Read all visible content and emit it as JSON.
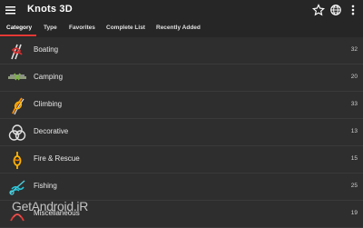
{
  "app": {
    "title": "Knots 3D"
  },
  "tabs": [
    {
      "label": "Category",
      "active": true
    },
    {
      "label": "Type",
      "active": false
    },
    {
      "label": "Favorites",
      "active": false
    },
    {
      "label": "Complete List",
      "active": false
    },
    {
      "label": "Recently Added",
      "active": false
    }
  ],
  "categories": [
    {
      "label": "Boating",
      "count": "32",
      "icon": "boating-knot-icon"
    },
    {
      "label": "Camping",
      "count": "20",
      "icon": "camping-knot-icon"
    },
    {
      "label": "Climbing",
      "count": "33",
      "icon": "climbing-knot-icon"
    },
    {
      "label": "Decorative",
      "count": "13",
      "icon": "decorative-knot-icon"
    },
    {
      "label": "Fire & Rescue",
      "count": "15",
      "icon": "fire-rescue-knot-icon"
    },
    {
      "label": "Fishing",
      "count": "25",
      "icon": "fishing-knot-icon"
    },
    {
      "label": "Miscellaneous",
      "count": "19",
      "icon": "miscellaneous-knot-icon"
    }
  ],
  "watermark": "GetAndroid.iR",
  "colors": {
    "accent": "#e53935",
    "background": "#2e2e2e",
    "toolbar": "#262626"
  }
}
